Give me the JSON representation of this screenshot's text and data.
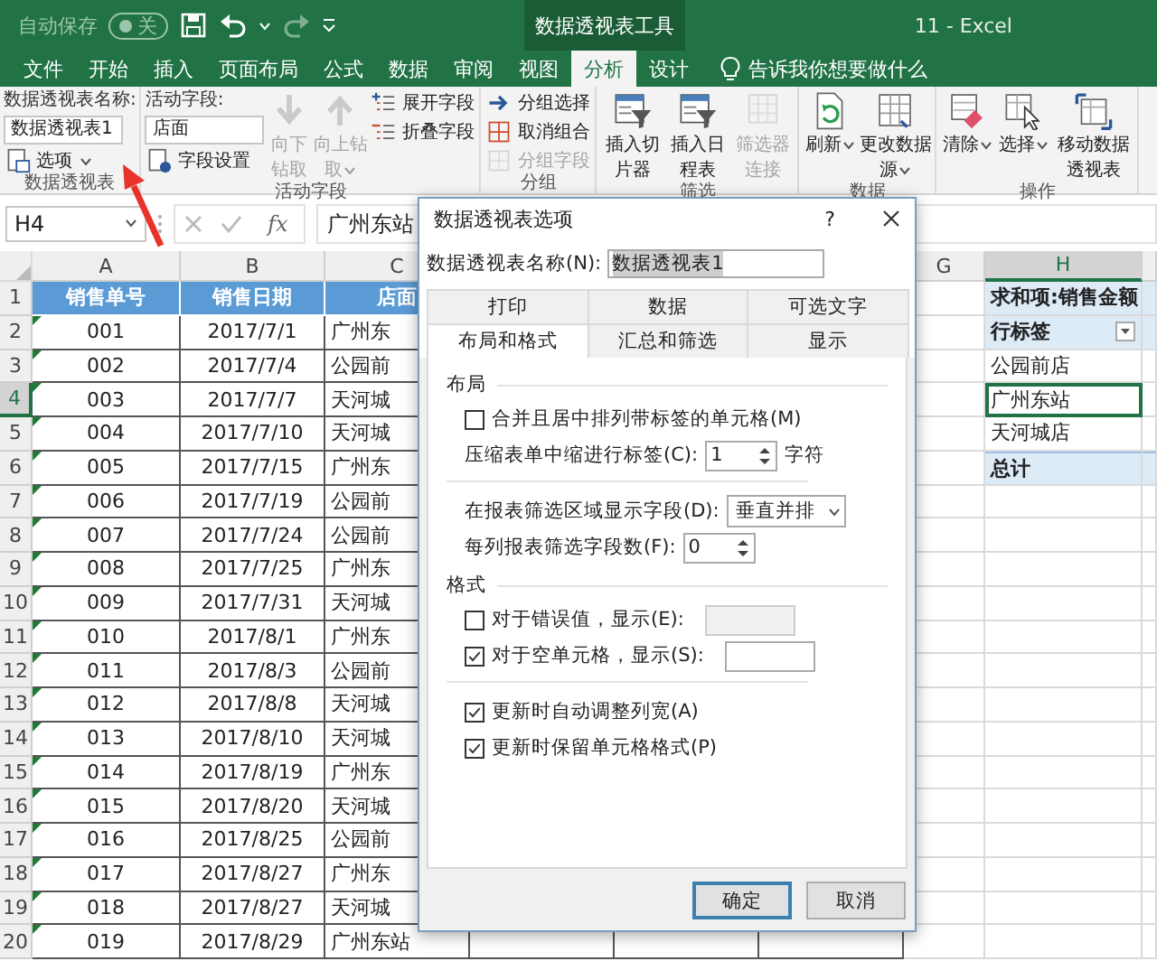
{
  "title_bar": {
    "autosave": {
      "label": "自动保存",
      "toggle_text": "关",
      "on": false
    },
    "context_title": "数据透视表工具",
    "window_title": "11 - Excel"
  },
  "tabs": [
    {
      "label": "文件",
      "selected": false
    },
    {
      "label": "开始",
      "selected": false
    },
    {
      "label": "插入",
      "selected": false
    },
    {
      "label": "页面布局",
      "selected": false
    },
    {
      "label": "公式",
      "selected": false
    },
    {
      "label": "数据",
      "selected": false
    },
    {
      "label": "审阅",
      "selected": false
    },
    {
      "label": "视图",
      "selected": false
    },
    {
      "label": "分析",
      "selected": true
    },
    {
      "label": "设计",
      "selected": false
    }
  ],
  "tell_me": "告诉我你想要做什么",
  "ribbon": {
    "groups": [
      {
        "label": "数据透视表",
        "columns": [
          [
            {
              "kind": "caption",
              "label": "数据透视表名称:"
            },
            {
              "kind": "field",
              "value": "数据透视表1"
            },
            {
              "kind": "small",
              "label": "选项",
              "disabled": false,
              "dropdown": true
            }
          ]
        ]
      },
      {
        "label": "活动字段",
        "columns": [
          [
            {
              "kind": "caption",
              "label": "活动字段:"
            },
            {
              "kind": "field",
              "value": "店面"
            },
            {
              "kind": "small",
              "label": "字段设置",
              "disabled": false,
              "dropdown": false
            }
          ],
          [
            {
              "kind": "large",
              "label": "向下钻取",
              "disabled": true,
              "dropdown": false
            }
          ],
          [
            {
              "kind": "large",
              "label": "向上钻取",
              "disabled": true,
              "dropdown": true
            }
          ],
          [
            {
              "kind": "small",
              "label": "展开字段",
              "disabled": false,
              "dropdown": false
            },
            {
              "kind": "small",
              "label": "折叠字段",
              "disabled": false,
              "dropdown": false
            }
          ]
        ]
      },
      {
        "label": "分组",
        "columns": [
          [
            {
              "kind": "small",
              "label": "分组选择",
              "disabled": false,
              "dropdown": false
            },
            {
              "kind": "small",
              "label": "取消组合",
              "disabled": false,
              "dropdown": false
            },
            {
              "kind": "small",
              "label": "分组字段",
              "disabled": true,
              "dropdown": false
            }
          ]
        ]
      },
      {
        "label": "筛选",
        "columns": [
          [
            {
              "kind": "large",
              "label": "插入切片器",
              "disabled": false,
              "dropdown": false
            }
          ],
          [
            {
              "kind": "large",
              "label": "插入日程表",
              "disabled": false,
              "dropdown": false
            }
          ],
          [
            {
              "kind": "large",
              "label": "筛选器连接",
              "disabled": true,
              "dropdown": false
            }
          ]
        ]
      },
      {
        "label": "数据",
        "columns": [
          [
            {
              "kind": "large",
              "label": "刷新",
              "disabled": false,
              "dropdown": true
            }
          ],
          [
            {
              "kind": "large",
              "label": "更改数据源",
              "disabled": false,
              "dropdown": true
            }
          ]
        ]
      },
      {
        "label": "操作",
        "columns": [
          [
            {
              "kind": "large",
              "label": "清除",
              "disabled": false,
              "dropdown": true
            }
          ],
          [
            {
              "kind": "large",
              "label": "选择",
              "disabled": false,
              "dropdown": true
            }
          ],
          [
            {
              "kind": "large",
              "label": "移动数据透视表",
              "disabled": false,
              "dropdown": false
            }
          ]
        ]
      }
    ]
  },
  "formula_bar": {
    "name_box": "H4",
    "insert_function": "fx",
    "formula": "广州东站"
  },
  "sheet": {
    "left_columns": [
      "A",
      "B",
      "C"
    ],
    "right_columns": [
      "G",
      "H"
    ],
    "rows": [
      {
        "row": "1",
        "id": "销售单号",
        "date": "销售日期",
        "store": "店面"
      },
      {
        "row": "2",
        "id": "001",
        "date": "2017/7/1",
        "store": "广州东",
        "flag": true
      },
      {
        "row": "3",
        "id": "002",
        "date": "2017/7/4",
        "store": "公园前",
        "flag": true
      },
      {
        "row": "4",
        "id": "003",
        "date": "2017/7/7",
        "store": "天河城",
        "flag": true
      },
      {
        "row": "5",
        "id": "004",
        "date": "2017/7/10",
        "store": "天河城",
        "flag": true
      },
      {
        "row": "6",
        "id": "005",
        "date": "2017/7/15",
        "store": "广州东",
        "flag": true
      },
      {
        "row": "7",
        "id": "006",
        "date": "2017/7/19",
        "store": "公园前",
        "flag": true
      },
      {
        "row": "8",
        "id": "007",
        "date": "2017/7/24",
        "store": "公园前",
        "flag": true
      },
      {
        "row": "9",
        "id": "008",
        "date": "2017/7/25",
        "store": "广州东",
        "flag": true
      },
      {
        "row": "10",
        "id": "009",
        "date": "2017/7/31",
        "store": "天河城",
        "flag": true
      },
      {
        "row": "11",
        "id": "010",
        "date": "2017/8/1",
        "store": "广州东",
        "flag": true
      },
      {
        "row": "12",
        "id": "011",
        "date": "2017/8/3",
        "store": "公园前",
        "flag": true
      },
      {
        "row": "13",
        "id": "012",
        "date": "2017/8/8",
        "store": "天河城",
        "flag": true
      },
      {
        "row": "14",
        "id": "013",
        "date": "2017/8/10",
        "store": "天河城",
        "flag": true
      },
      {
        "row": "15",
        "id": "014",
        "date": "2017/8/19",
        "store": "广州东",
        "flag": true
      },
      {
        "row": "16",
        "id": "015",
        "date": "2017/8/20",
        "store": "天河城",
        "flag": true
      },
      {
        "row": "17",
        "id": "016",
        "date": "2017/8/25",
        "store": "公园前",
        "flag": true
      },
      {
        "row": "18",
        "id": "017",
        "date": "2017/8/27",
        "store": "广州东",
        "flag": true
      },
      {
        "row": "19",
        "id": "018",
        "date": "2017/8/27",
        "store": "天河城",
        "flag": true
      },
      {
        "row": "20",
        "id": "019",
        "date": "2017/8/29",
        "store": "广州东站",
        "flag": true
      }
    ],
    "pivot": [
      {
        "kind": "header",
        "text": "求和项:销售金额",
        "selected": false,
        "filter": false
      },
      {
        "kind": "header",
        "text": "行标签",
        "selected": false,
        "filter": true
      },
      {
        "kind": "item",
        "text": "公园前店",
        "selected": false,
        "filter": false
      },
      {
        "kind": "item",
        "text": "广州东站",
        "selected": true,
        "filter": false
      },
      {
        "kind": "item",
        "text": "天河城店",
        "selected": false,
        "filter": false
      },
      {
        "kind": "total",
        "text": "总计",
        "selected": false,
        "filter": false
      }
    ]
  },
  "dialog": {
    "title": "数据透视表选项",
    "help": "?",
    "name_label": "数据透视表名称(N):",
    "name_value": "数据透视表1",
    "tab_rows": [
      [
        {
          "label": "打印",
          "selected": false
        },
        {
          "label": "数据",
          "selected": false
        },
        {
          "label": "可选文字",
          "selected": false
        }
      ],
      [
        {
          "label": "布局和格式",
          "selected": true
        },
        {
          "label": "汇总和筛选",
          "selected": false
        },
        {
          "label": "显示",
          "selected": false
        }
      ]
    ],
    "controls": [
      {
        "kind": "heading",
        "label": "布局"
      },
      {
        "kind": "checkbox",
        "label": "合并且居中排列带标签的单元格(M)",
        "checked": false
      },
      {
        "kind": "spinner",
        "label": "压缩表单中缩进行标签(C):",
        "value": "1",
        "suffix": "字符"
      },
      {
        "kind": "divider"
      },
      {
        "kind": "dropdown",
        "label": "在报表筛选区域显示字段(D):",
        "value": "垂直并排"
      },
      {
        "kind": "spinner",
        "label": "每列报表筛选字段数(F):",
        "value": "0"
      },
      {
        "kind": "heading",
        "label": "格式"
      },
      {
        "kind": "checkbox_field",
        "label": "对于错误值，显示(E):",
        "checked": false,
        "field_disabled": true
      },
      {
        "kind": "checkbox_field",
        "label": "对于空单元格，显示(S):",
        "checked": true,
        "field_disabled": false
      },
      {
        "kind": "divider"
      },
      {
        "kind": "checkbox",
        "label": "更新时自动调整列宽(A)",
        "checked": true
      },
      {
        "kind": "checkbox",
        "label": "更新时保留单元格格式(P)",
        "checked": true
      }
    ],
    "buttons": [
      {
        "label": "确定",
        "default": true
      },
      {
        "label": "取消",
        "default": false
      }
    ]
  }
}
